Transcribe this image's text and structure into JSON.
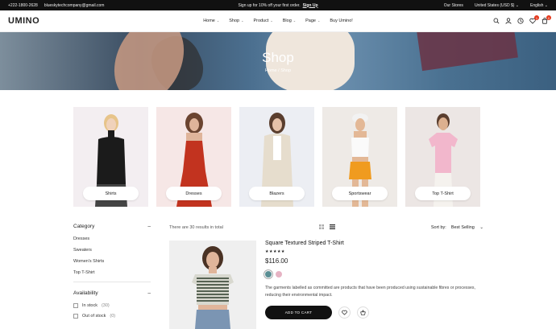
{
  "topbar": {
    "phone": "+222-1800-2628",
    "email": "blueskytechcompany@gmail.com",
    "promo": "Sign up for 10% off your first order.",
    "promo_link": "Sign Up",
    "stores": "Our Stores",
    "currency": "United States (USD $)",
    "language": "English"
  },
  "header": {
    "logo": "UMINO",
    "nav": [
      {
        "label": "Home"
      },
      {
        "label": "Shop"
      },
      {
        "label": "Product"
      },
      {
        "label": "Blog"
      },
      {
        "label": "Page"
      },
      {
        "label": "Buy Umino!"
      }
    ],
    "wishlist_count": "1",
    "cart_count": "0",
    "chevron": "⌄"
  },
  "hero": {
    "title": "Shop",
    "breadcrumb_home": "Home",
    "breadcrumb_sep": "/",
    "breadcrumb_current": "Shop"
  },
  "categories": [
    {
      "label": "Shirts",
      "bg": "#f3eef1"
    },
    {
      "label": "Dresses",
      "bg": "#f6e7e6"
    },
    {
      "label": "Blazers",
      "bg": "#eceef3"
    },
    {
      "label": "Sportswear",
      "bg": "#eeeae6"
    },
    {
      "label": "Top T-Shirt",
      "bg": "#ece6e4"
    }
  ],
  "sidebar": {
    "category_title": "Category",
    "categories": [
      "Dresses",
      "Sweaters",
      "Women's Shirts",
      "Top T-Shirt"
    ],
    "availability_title": "Availability",
    "availability": [
      {
        "label": "In stock",
        "count": "(30)"
      },
      {
        "label": "Out of stock",
        "count": "(0)"
      }
    ],
    "collapse_symbol": "–"
  },
  "results": {
    "text": "There are 30 results in total",
    "sort_label": "Sort by:",
    "sort_value": "Best Selling"
  },
  "product": {
    "name": "Square Textured Striped T-Shirt",
    "stars": "★★★★★",
    "price": "$116.00",
    "swatches": [
      "#5b8f94",
      "#e6b3c3"
    ],
    "description": "The garments labelled as committed are products that have been produced using sustainable fibres or processes, reducing their environmental impact.",
    "add_to_cart": "ADD TO CART"
  }
}
